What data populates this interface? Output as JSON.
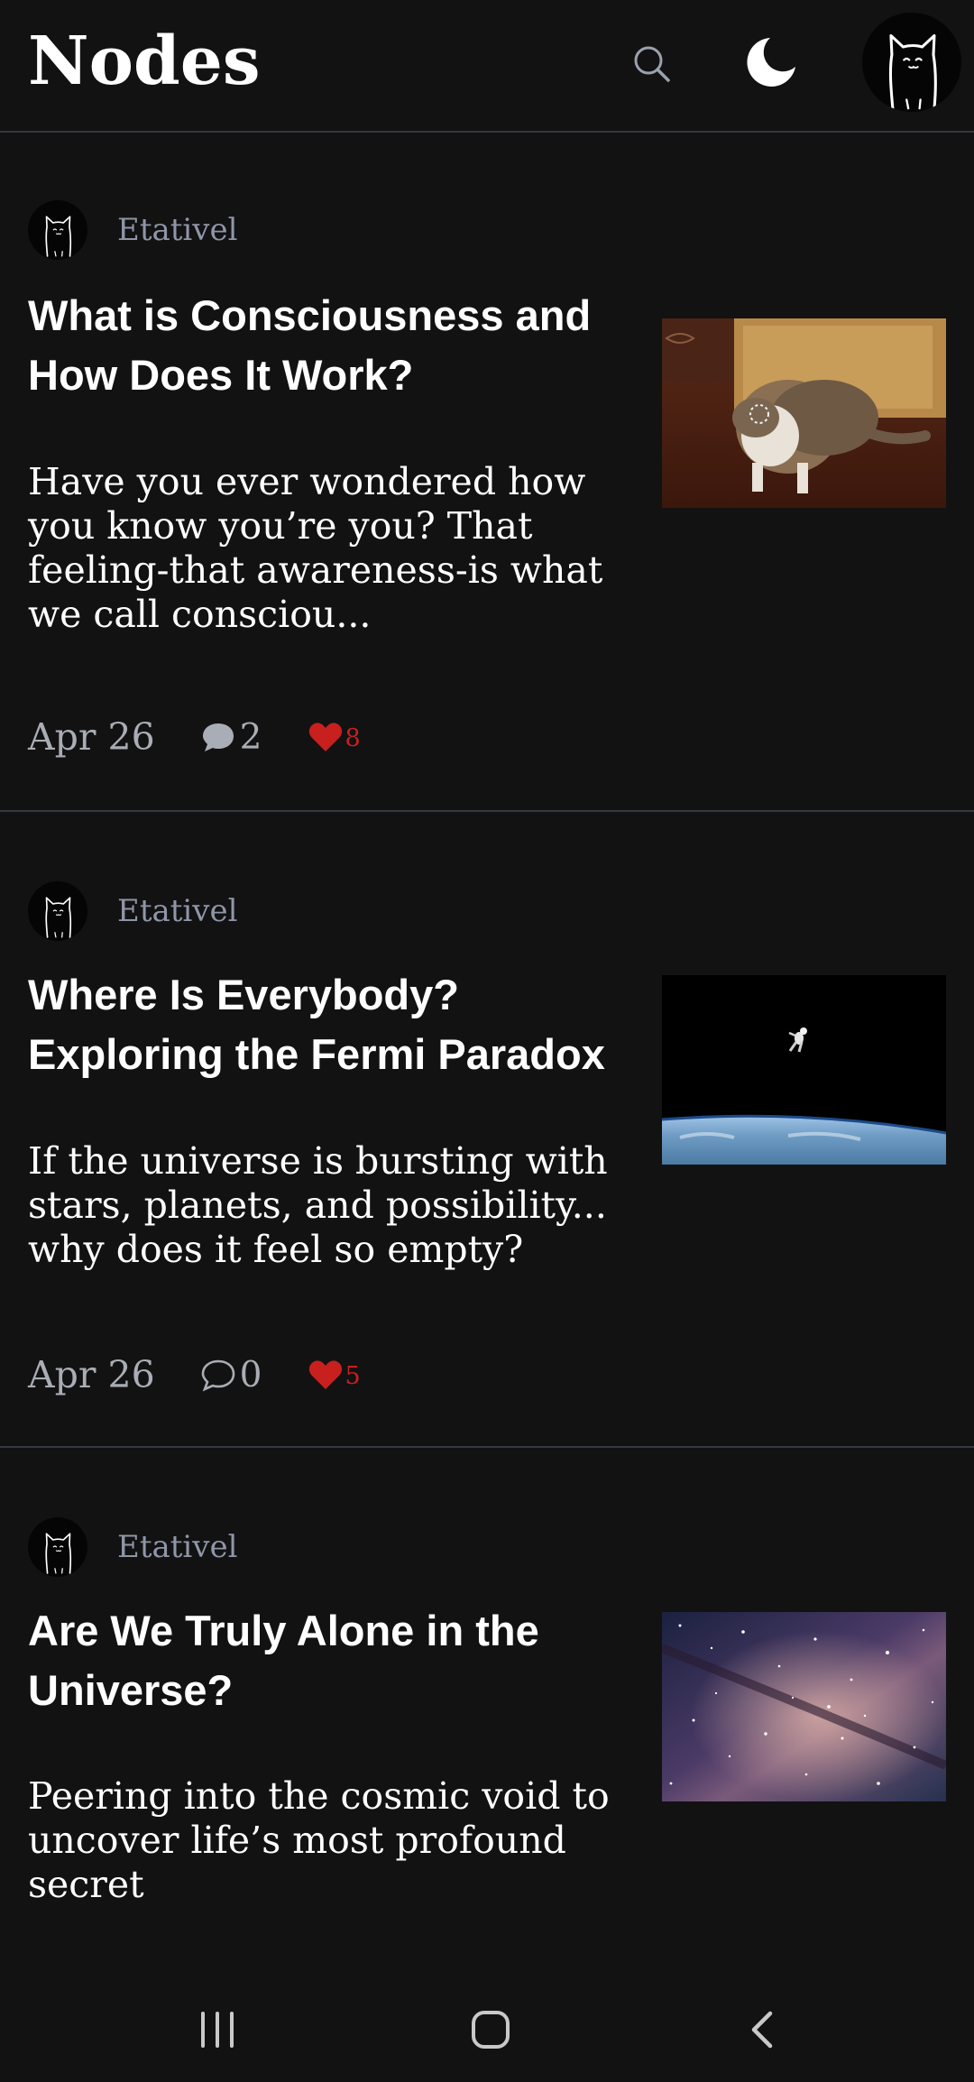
{
  "header": {
    "title": "Nodes",
    "search_icon": "search-icon",
    "theme_icon": "moon-icon",
    "avatar_icon": "cat-avatar"
  },
  "posts": [
    {
      "author": "Etativel",
      "title": "What is Consciousness and How Does It Work?",
      "excerpt": "Have you ever wondered how you know you’re you? That feeling-that awareness-is what we call consciou...",
      "date": "Apr 26",
      "comments": "2",
      "likes": "8",
      "comment_icon": "comment-filled-icon",
      "thumbnail": "cat-photo"
    },
    {
      "author": "Etativel",
      "title": "Where Is Everybody? Exploring the Fermi Paradox",
      "excerpt": "If the universe is bursting with stars, planets, and possibility... why does it feel so empty?",
      "date": "Apr 26",
      "comments": "0",
      "likes": "5",
      "comment_icon": "comment-outline-icon",
      "thumbnail": "astronaut-over-earth-photo"
    },
    {
      "author": "Etativel",
      "title": "Are We Truly Alone in the Universe?",
      "excerpt": "Peering into the cosmic void to uncover life’s most profound secret",
      "thumbnail": "milky-way-photo"
    }
  ],
  "navbar": {
    "recents_icon": "recents-icon",
    "home_icon": "home-icon",
    "back_icon": "back-icon"
  },
  "colors": {
    "background": "#121212",
    "divider": "#34383f",
    "author": "#8f96a8",
    "meta": "#a9adb5",
    "like": "#c8201f"
  }
}
